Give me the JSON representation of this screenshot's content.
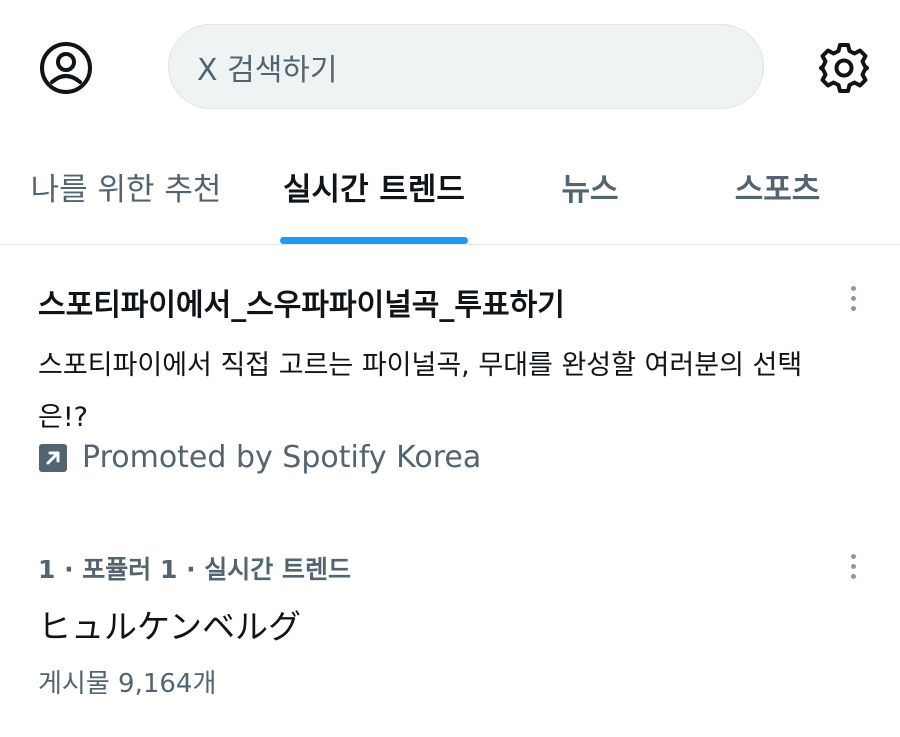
{
  "header": {
    "search_placeholder": "X 검색하기",
    "avatar_icon": "account-circle-icon",
    "settings_icon": "gear-icon"
  },
  "tabs": [
    {
      "label": "나를 위한 추천",
      "active": false
    },
    {
      "label": "실시간 트렌드",
      "active": true
    },
    {
      "label": "뉴스",
      "active": false
    },
    {
      "label": "스포츠",
      "active": false
    }
  ],
  "promo": {
    "title": "스포티파이에서_스우파파이널곡_투표하기",
    "description": "스포티파이에서 직접 고르는 파이널곡, 무대를 완성할 여러분의 선택은!?",
    "promoted_by": "Promoted by Spotify Korea",
    "icon": "promoted-arrow-icon"
  },
  "trend": {
    "meta": "1 · 포퓰러 1 · 실시간 트렌드",
    "name": "ヒュルケンベルグ",
    "count": "게시물 9,164개"
  },
  "colors": {
    "accent": "#1d9bf0",
    "text": "#0f1419",
    "secondary": "#536471",
    "search_bg": "#eff3f4"
  }
}
